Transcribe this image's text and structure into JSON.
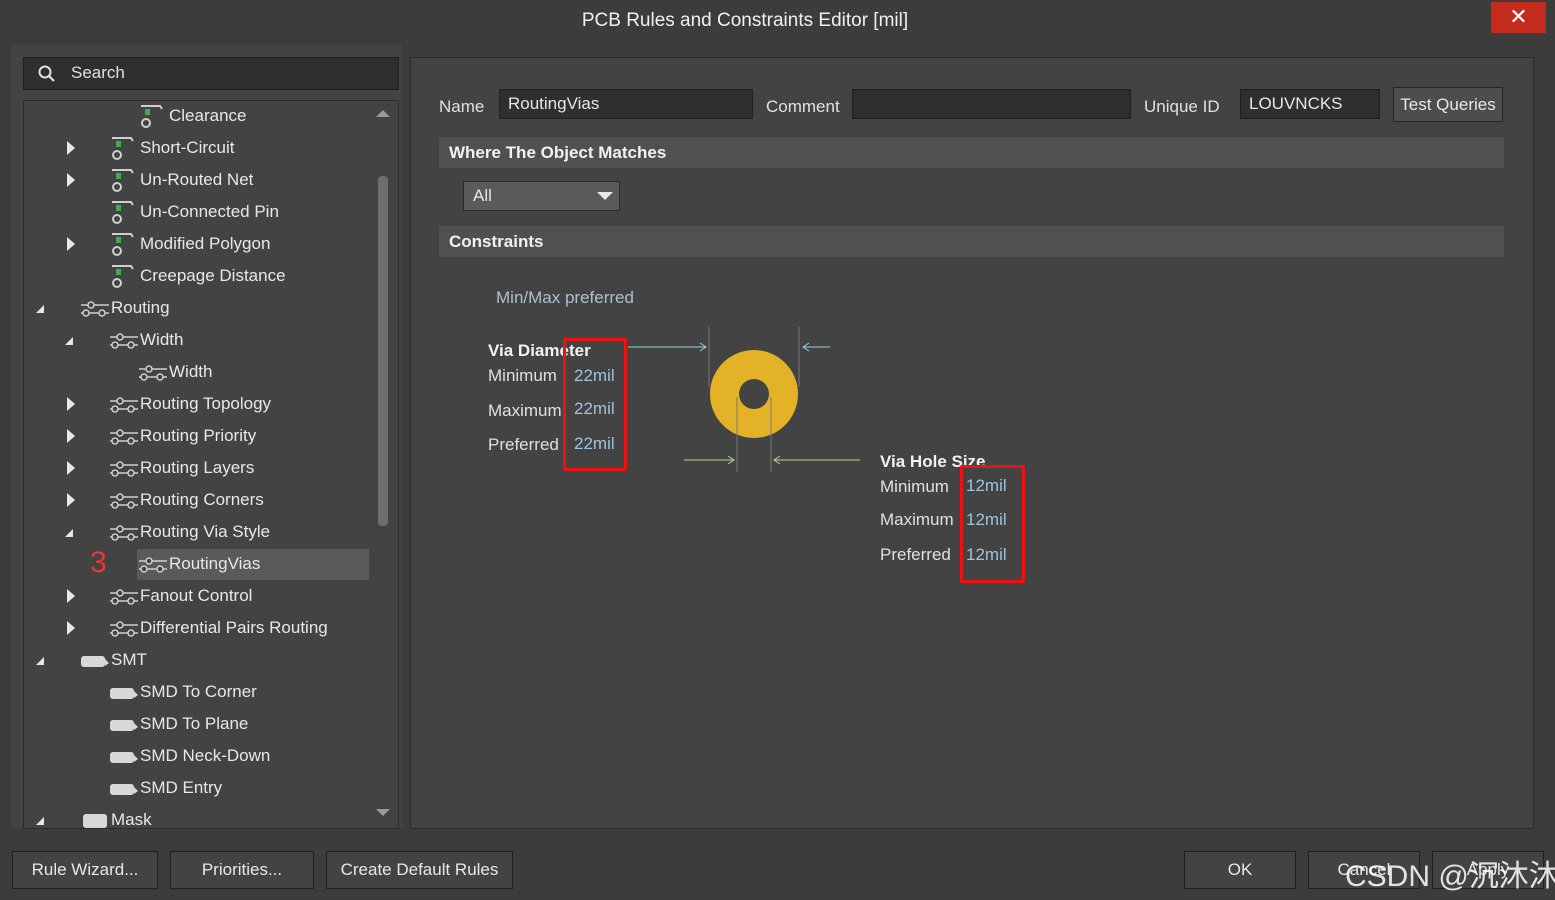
{
  "window": {
    "title": "PCB Rules and Constraints Editor [mil]",
    "close": "✕"
  },
  "search": {
    "placeholder": "Search"
  },
  "tree": {
    "items": [
      {
        "label": "Clearance",
        "indent": 2,
        "toggle": "none",
        "icon": "rule-clearance-icon"
      },
      {
        "label": "Short-Circuit",
        "indent": 1,
        "toggle": "collapsed",
        "icon": "rule-clearance-icon"
      },
      {
        "label": "Un-Routed Net",
        "indent": 1,
        "toggle": "collapsed",
        "icon": "rule-clearance-icon"
      },
      {
        "label": "Un-Connected Pin",
        "indent": 1,
        "toggle": "none",
        "icon": "rule-clearance-icon"
      },
      {
        "label": "Modified Polygon",
        "indent": 1,
        "toggle": "collapsed",
        "icon": "rule-clearance-icon"
      },
      {
        "label": "Creepage Distance",
        "indent": 1,
        "toggle": "none",
        "icon": "rule-clearance-icon"
      },
      {
        "label": "Routing",
        "indent": 0,
        "toggle": "expanded",
        "icon": "routing-icon"
      },
      {
        "label": "Width",
        "indent": 1,
        "toggle": "expanded",
        "icon": "routing-icon"
      },
      {
        "label": "Width",
        "indent": 2,
        "toggle": "none",
        "icon": "routing-icon"
      },
      {
        "label": "Routing Topology",
        "indent": 1,
        "toggle": "collapsed",
        "icon": "routing-icon"
      },
      {
        "label": "Routing Priority",
        "indent": 1,
        "toggle": "collapsed",
        "icon": "routing-icon"
      },
      {
        "label": "Routing Layers",
        "indent": 1,
        "toggle": "collapsed",
        "icon": "routing-icon"
      },
      {
        "label": "Routing Corners",
        "indent": 1,
        "toggle": "collapsed",
        "icon": "routing-icon"
      },
      {
        "label": "Routing Via Style",
        "indent": 1,
        "toggle": "expanded",
        "icon": "routing-icon"
      },
      {
        "label": "RoutingVias",
        "indent": 2,
        "toggle": "none",
        "icon": "routing-icon",
        "selected": true
      },
      {
        "label": "Fanout Control",
        "indent": 1,
        "toggle": "collapsed",
        "icon": "routing-icon"
      },
      {
        "label": "Differential Pairs Routing",
        "indent": 1,
        "toggle": "collapsed",
        "icon": "routing-icon"
      },
      {
        "label": "SMT",
        "indent": 0,
        "toggle": "expanded",
        "icon": "smt-icon"
      },
      {
        "label": "SMD To Corner",
        "indent": 1,
        "toggle": "none",
        "icon": "smt-icon"
      },
      {
        "label": "SMD To Plane",
        "indent": 1,
        "toggle": "none",
        "icon": "smt-icon"
      },
      {
        "label": "SMD Neck-Down",
        "indent": 1,
        "toggle": "none",
        "icon": "smt-icon"
      },
      {
        "label": "SMD Entry",
        "indent": 1,
        "toggle": "none",
        "icon": "smt-icon"
      },
      {
        "label": "Mask",
        "indent": 0,
        "toggle": "expanded",
        "icon": "mask-icon"
      }
    ],
    "step_marker": "3"
  },
  "rule": {
    "name_label": "Name",
    "name_value": "RoutingVias",
    "comment_label": "Comment",
    "comment_value": "",
    "uid_label": "Unique ID",
    "uid_value": "LOUVNCKS",
    "test_queries": "Test Queries"
  },
  "where": {
    "title": "Where The Object Matches",
    "selected": "All"
  },
  "constraints": {
    "title": "Constraints",
    "mode": "Min/Max preferred",
    "via_diameter": {
      "title": "Via Diameter",
      "minimum_label": "Minimum",
      "minimum": "22mil",
      "maximum_label": "Maximum",
      "maximum": "22mil",
      "preferred_label": "Preferred",
      "preferred": "22mil"
    },
    "via_hole": {
      "title": "Via Hole Size",
      "minimum_label": "Minimum",
      "minimum": "12mil",
      "maximum_label": "Maximum",
      "maximum": "12mil",
      "preferred_label": "Preferred",
      "preferred": "12mil"
    },
    "via_color": "#e3b227"
  },
  "footer": {
    "rule_wizard": "Rule Wizard...",
    "priorities": "Priorities...",
    "create_default": "Create Default Rules",
    "ok": "OK",
    "cancel": "Cancel",
    "apply": "Apply",
    "watermark": "CSDN @沉沐沐"
  }
}
